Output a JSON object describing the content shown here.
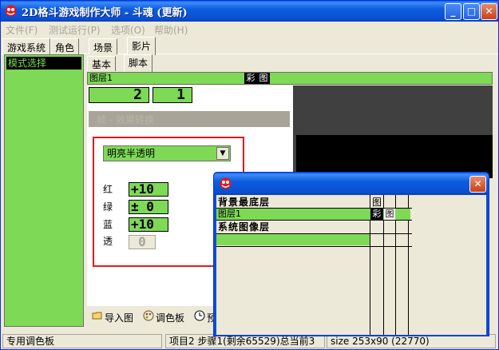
{
  "window": {
    "title": "2D格斗游戏制作大师 - 斗魂 (更新)",
    "minimize": "_",
    "maximize": "□",
    "close": "✕"
  },
  "menu": [
    "文件(F)",
    "测试运行(P)",
    "选项(O)",
    "帮助(H)"
  ],
  "tabs_main": [
    "游戏系统",
    "角色",
    "场景",
    "影片"
  ],
  "tabs_main_active": "影片",
  "left_list": [
    "模式选择"
  ],
  "tabs_sub": [
    "基本",
    "脚本"
  ],
  "tabs_sub_active": "脚本",
  "layer_bar": {
    "label": "图层1",
    "icon1": "彩",
    "icon2": "图"
  },
  "num1": "2",
  "num2": "1",
  "gray_header": "帧 - 效果转换",
  "blend_mode": "明亮半透明",
  "colors": {
    "red_label": "红",
    "red_value": "+10",
    "green_label": "绿",
    "green_value": "± 0",
    "blue_label": "蓝",
    "blue_value": "+10",
    "alpha_label": "透",
    "alpha_value": "0"
  },
  "bottom_buttons": {
    "import": "导入图",
    "palette": "调色板",
    "preview": "预"
  },
  "status": {
    "left": "专用调色板",
    "middle": "项目2 步骤1(剩余65529)总当前3",
    "right": "size 253x90 (22770)"
  },
  "popup": {
    "close": "✕",
    "rows": [
      {
        "label": "背景最底层",
        "col1": "图"
      },
      {
        "label": "图层1",
        "col1": "彩",
        "col2": "图"
      },
      {
        "label": "系统图像层"
      }
    ]
  },
  "accent_green": "#7ed957",
  "accent_red": "#e8161c"
}
